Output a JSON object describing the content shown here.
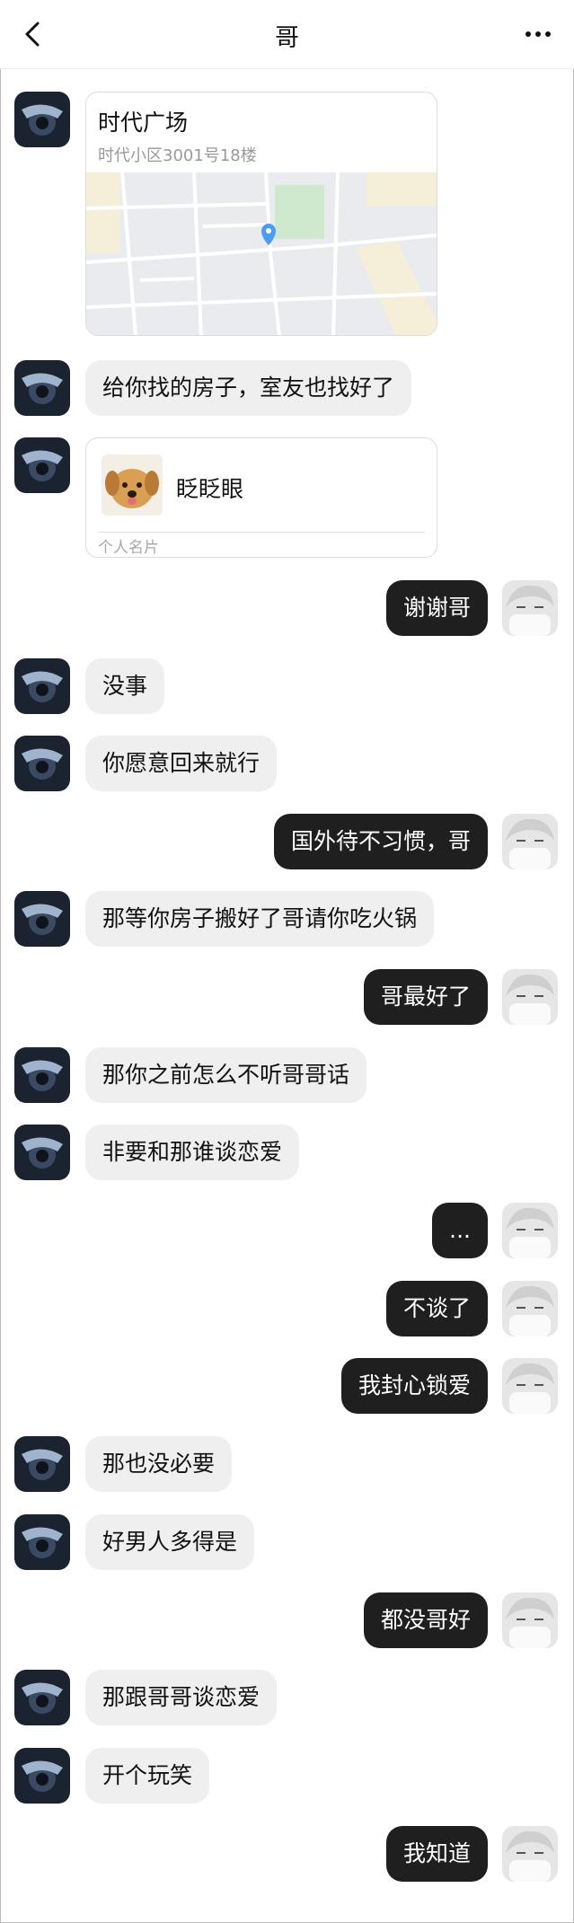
{
  "header": {
    "title": "哥"
  },
  "location_card": {
    "name": "时代广场",
    "address": "时代小区3001号18楼"
  },
  "contact_card": {
    "name": "眨眨眼",
    "type": "个人名片"
  },
  "messages": {
    "m1": {
      "side": "in",
      "text": "给你找的房子，室友也找好了"
    },
    "m2": {
      "side": "out",
      "text": "谢谢哥"
    },
    "m3": {
      "side": "in",
      "text": "没事"
    },
    "m4": {
      "side": "in",
      "text": "你愿意回来就行"
    },
    "m5": {
      "side": "out",
      "text": "国外待不习惯，哥"
    },
    "m6": {
      "side": "in",
      "text": "那等你房子搬好了哥请你吃火锅"
    },
    "m7": {
      "side": "out",
      "text": "哥最好了"
    },
    "m8": {
      "side": "in",
      "text": "那你之前怎么不听哥哥话"
    },
    "m9": {
      "side": "in",
      "text": "非要和那谁谈恋爱"
    },
    "m10": {
      "side": "out",
      "text": "..."
    },
    "m11": {
      "side": "out",
      "text": "不谈了"
    },
    "m12": {
      "side": "out",
      "text": "我封心锁爱"
    },
    "m13": {
      "side": "in",
      "text": "那也没必要"
    },
    "m14": {
      "side": "in",
      "text": "好男人多得是"
    },
    "m15": {
      "side": "out",
      "text": "都没哥好"
    },
    "m16": {
      "side": "in",
      "text": "那跟哥哥谈恋爱"
    },
    "m17": {
      "side": "in",
      "text": "开个玩笑"
    },
    "m18": {
      "side": "out",
      "text": "我知道"
    }
  },
  "icons": {
    "back": "chevron-left-icon",
    "more": "more-dots-icon",
    "map_pin": "map-pin-icon"
  },
  "colors": {
    "incoming_bubble": "#efefef",
    "outgoing_bubble": "#1f1f1f",
    "map_pin": "#4a9df0",
    "map_park": "#cfe9cf"
  }
}
